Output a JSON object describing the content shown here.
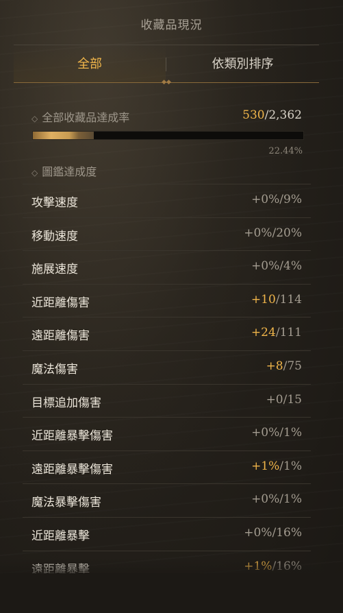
{
  "header": {
    "title": "收藏品現況"
  },
  "tabs": [
    {
      "label": "全部",
      "active": true
    },
    {
      "label": "依類別排序",
      "active": false
    }
  ],
  "overall": {
    "label": "全部收藏品達成率",
    "owned": "530",
    "total": "2,362",
    "percent_text": "22.44%",
    "progress_fraction": 0.2244
  },
  "codex": {
    "label": "圖鑑達成度"
  },
  "rows": [
    {
      "name": "攻擊速度",
      "bonus": "+0%",
      "max": "9%",
      "positive": false
    },
    {
      "name": "移動速度",
      "bonus": "+0%",
      "max": "20%",
      "positive": false
    },
    {
      "name": "施展速度",
      "bonus": "+0%",
      "max": "4%",
      "positive": false
    },
    {
      "name": "近距離傷害",
      "bonus": "+10",
      "max": "114",
      "positive": true
    },
    {
      "name": "遠距離傷害",
      "bonus": "+24",
      "max": "111",
      "positive": true
    },
    {
      "name": "魔法傷害",
      "bonus": "+8",
      "max": "75",
      "positive": true
    },
    {
      "name": "目標追加傷害",
      "bonus": "+0",
      "max": "15",
      "positive": false
    },
    {
      "name": "近距離暴擊傷害",
      "bonus": "+0%",
      "max": "1%",
      "positive": false
    },
    {
      "name": "遠距離暴擊傷害",
      "bonus": "+1%",
      "max": "1%",
      "positive": true
    },
    {
      "name": "魔法暴擊傷害",
      "bonus": "+0%",
      "max": "1%",
      "positive": false
    },
    {
      "name": "近距離暴擊",
      "bonus": "+0%",
      "max": "16%",
      "positive": false
    },
    {
      "name": "遠距離暴擊",
      "bonus": "+1%",
      "max": "16%",
      "positive": true
    }
  ],
  "colors": {
    "accent": "#f0b54a",
    "text": "#ece6da",
    "muted": "#a49d91"
  }
}
